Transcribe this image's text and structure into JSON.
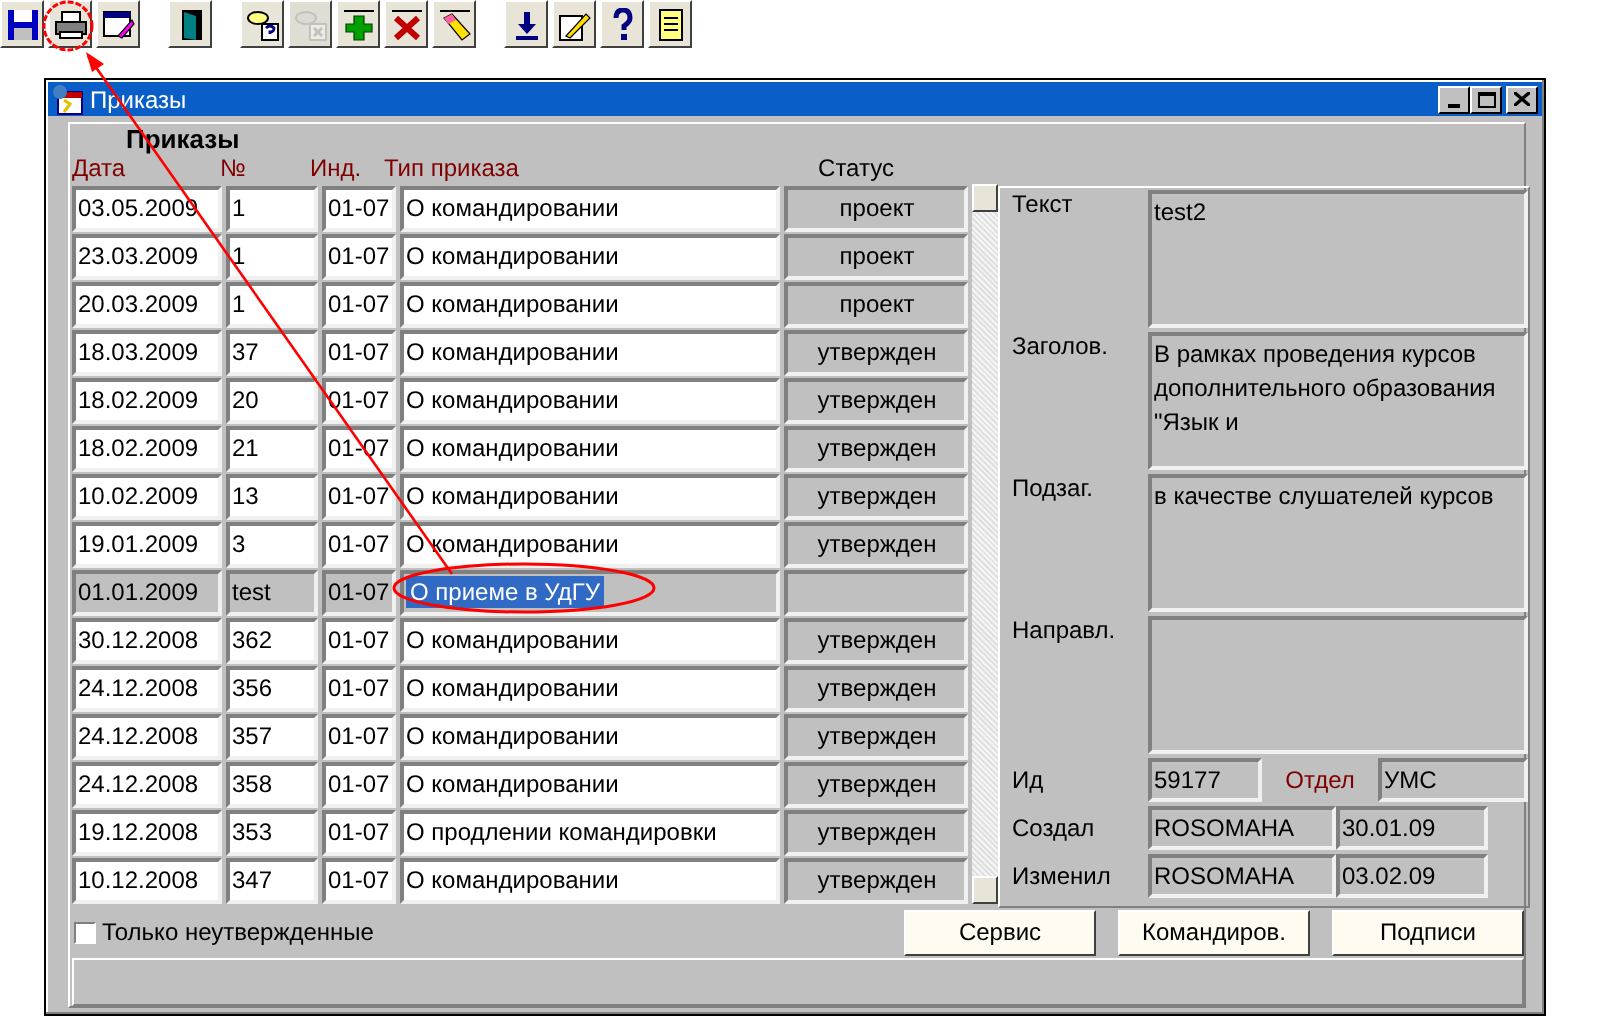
{
  "toolbar": [
    [
      {
        "kind": "save",
        "disabled": false
      },
      {
        "kind": "print",
        "disabled": false
      },
      {
        "kind": "edit-window",
        "disabled": false
      }
    ],
    [
      {
        "kind": "door",
        "disabled": false
      }
    ],
    [
      {
        "kind": "query",
        "disabled": false
      },
      {
        "kind": "query-cancel",
        "disabled": true
      },
      {
        "kind": "add",
        "disabled": false
      },
      {
        "kind": "delete",
        "disabled": false
      },
      {
        "kind": "eraser",
        "disabled": false
      }
    ],
    [
      {
        "kind": "download",
        "disabled": false
      },
      {
        "kind": "pencil",
        "disabled": false
      },
      {
        "kind": "help",
        "disabled": false
      },
      {
        "kind": "note",
        "disabled": false
      }
    ]
  ],
  "window": {
    "title": "Приказы"
  },
  "grid": {
    "title": "Приказы",
    "columns": [
      "Дата",
      "№",
      "Инд.",
      "Тип приказа",
      "Статус"
    ],
    "rows": [
      {
        "date": "03.05.2009",
        "number": "1",
        "index": "01-07",
        "type": "О командировании",
        "status": "проект",
        "selected": false
      },
      {
        "date": "23.03.2009",
        "number": "1",
        "index": "01-07",
        "type": "О командировании",
        "status": "проект",
        "selected": false
      },
      {
        "date": "20.03.2009",
        "number": "1",
        "index": "01-07",
        "type": "О командировании",
        "status": "проект",
        "selected": false
      },
      {
        "date": "18.03.2009",
        "number": "37",
        "index": "01-07",
        "type": "О командировании",
        "status": "утвержден",
        "selected": false
      },
      {
        "date": "18.02.2009",
        "number": "20",
        "index": "01-07",
        "type": "О командировании",
        "status": "утвержден",
        "selected": false
      },
      {
        "date": "18.02.2009",
        "number": "21",
        "index": "01-07",
        "type": "О командировании",
        "status": "утвержден",
        "selected": false
      },
      {
        "date": "10.02.2009",
        "number": "13",
        "index": "01-07",
        "type": "О командировании",
        "status": "утвержден",
        "selected": false
      },
      {
        "date": "19.01.2009",
        "number": "3",
        "index": "01-07",
        "type": "О командировании",
        "status": "утвержден",
        "selected": false
      },
      {
        "date": "01.01.2009",
        "number": "test",
        "index": "01-07",
        "type": "О приеме в УдГУ",
        "status": "",
        "selected": true
      },
      {
        "date": "30.12.2008",
        "number": "362",
        "index": "01-07",
        "type": "О командировании",
        "status": "утвержден",
        "selected": false
      },
      {
        "date": "24.12.2008",
        "number": "356",
        "index": "01-07",
        "type": "О командировании",
        "status": "утвержден",
        "selected": false
      },
      {
        "date": "24.12.2008",
        "number": "357",
        "index": "01-07",
        "type": "О командировании",
        "status": "утвержден",
        "selected": false
      },
      {
        "date": "24.12.2008",
        "number": "358",
        "index": "01-07",
        "type": "О командировании",
        "status": "утвержден",
        "selected": false
      },
      {
        "date": "19.12.2008",
        "number": "353",
        "index": "01-07",
        "type": "О продлении командировки",
        "status": "утвержден",
        "selected": false
      },
      {
        "date": "10.12.2008",
        "number": "347",
        "index": "01-07",
        "type": "О командировании",
        "status": "утвержден",
        "selected": false
      }
    ]
  },
  "details": {
    "memos": [
      {
        "label": "Текст",
        "value": "test2"
      },
      {
        "label": "Заголов.",
        "value": "В рамках проведения курсов дополнительного образования \"Язык и"
      },
      {
        "label": "Подзаг.",
        "value": "в качестве слушателей курсов"
      },
      {
        "label": "Направл."
      }
    ],
    "id": {
      "label": "Ид",
      "value": "59177"
    },
    "department": {
      "label": "Отдел",
      "value": "УМС"
    },
    "created": {
      "label": "Создал",
      "user": "ROSOMAHA",
      "date": "30.01.09"
    },
    "modified": {
      "label": "Изменил",
      "user": "ROSOMAHA",
      "date": "03.02.09"
    }
  },
  "only_unapproved": {
    "label": "Только неутвержденные",
    "checked": false
  },
  "buttons": [
    "Сервис",
    "Командиров.",
    "Подписи"
  ]
}
